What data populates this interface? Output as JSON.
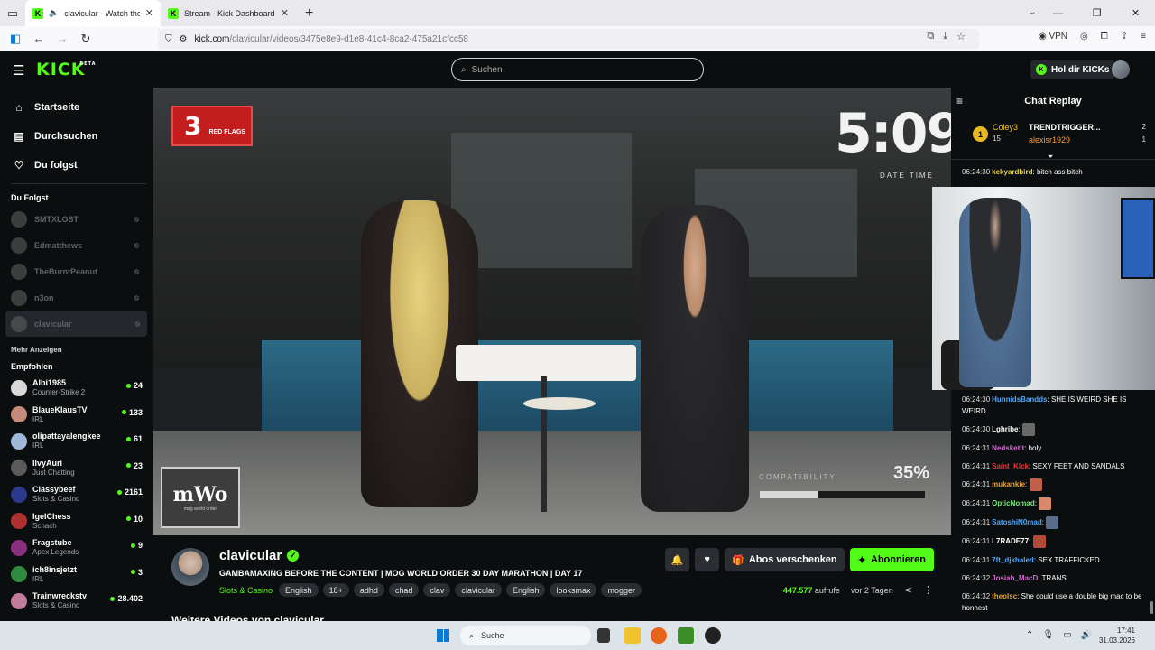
{
  "browser": {
    "tabs": [
      {
        "title": "clavicular - Watch the VOD",
        "active": true
      },
      {
        "title": "Stream - Kick Dashboard",
        "active": false
      }
    ],
    "url_host": "kick.com",
    "url_path": "/clavicular/videos/3475e8e9-d1e8-41c4-8ca2-475a21cfcc58",
    "vpn_label": "VPN"
  },
  "header": {
    "logo": "KICK",
    "logo_badge": "BETA",
    "search_placeholder": "Suchen",
    "kicks_button": "Hol dir KICKs"
  },
  "sidebar": {
    "nav": [
      {
        "label": "Startseite",
        "icon": "home-icon"
      },
      {
        "label": "Durchsuchen",
        "icon": "browse-icon"
      },
      {
        "label": "Du folgst",
        "icon": "heart-icon"
      }
    ],
    "following_title": "Du Folgst",
    "following": [
      {
        "name": "SMTXLOST"
      },
      {
        "name": "Edmatthews"
      },
      {
        "name": "TheBurntPeanut"
      },
      {
        "name": "n3on"
      },
      {
        "name": "clavicular"
      }
    ],
    "show_more": "Mehr Anzeigen",
    "recommended_title": "Empfohlen",
    "recommended": [
      {
        "name": "Albi1985",
        "category": "Counter-Strike 2",
        "viewers": "24",
        "color": "#d9d9d9"
      },
      {
        "name": "BlaueKlausTV",
        "category": "IRL",
        "viewers": "133",
        "color": "#c48a7a"
      },
      {
        "name": "olipattayalengkee",
        "category": "IRL",
        "viewers": "61",
        "color": "#9fb7d9"
      },
      {
        "name": "IlvyAuri",
        "category": "Just Chatting",
        "viewers": "23",
        "color": "#5a5a5a"
      },
      {
        "name": "Classybeef",
        "category": "Slots & Casino",
        "viewers": "2161",
        "color": "#2b3a8c"
      },
      {
        "name": "IgelChess",
        "category": "Schach",
        "viewers": "10",
        "color": "#b03030"
      },
      {
        "name": "Fragstube",
        "category": "Apex Legends",
        "viewers": "9",
        "color": "#8a2f7e"
      },
      {
        "name": "ich8insjetzt",
        "category": "IRL",
        "viewers": "3",
        "color": "#2e8a3c"
      },
      {
        "name": "Trainwreckstv",
        "category": "Slots & Casino",
        "viewers": "28.402",
        "color": "#c07a9a"
      }
    ]
  },
  "video": {
    "flags_count": "3",
    "flags_label": "RED FLAGS",
    "timer": "5:09",
    "timer_label": "DATE TIME",
    "compat_label": "COMPATIBILITY",
    "compat_value": "35%",
    "compat_fraction": 0.35,
    "watermark_big": "mWo",
    "watermark_small": "mog world order"
  },
  "stream": {
    "channel": "clavicular",
    "title": "GAMBAMAXING BEFORE THE CONTENT | MOG WORLD ORDER 30 DAY MARATHON | DAY 17",
    "category": "Slots & Casino",
    "tags": [
      "English",
      "18+",
      "adhd",
      "chad",
      "clav",
      "clavicular",
      "English",
      "looksmax",
      "mogger"
    ],
    "views": "447.577",
    "views_label": "aufrufe",
    "age": "vor 2 Tagen",
    "gift_subs": "Abos verschenken",
    "subscribe": "Abonnieren",
    "more_videos": "Weitere Videos von clavicular"
  },
  "chat": {
    "title": "Chat Replay",
    "leaderboard": {
      "left_rank": "1",
      "left_name": "Coley3",
      "left_count": "15",
      "right": [
        {
          "name": "TRENDTRIGGER...",
          "count": "2"
        },
        {
          "name": "alexisr1929",
          "count": "1"
        }
      ]
    },
    "messages": [
      {
        "time": "06:24:30",
        "user": "kekyardbird",
        "color": "#e8d642",
        "text": "bitch ass bitch"
      },
      {
        "time": "06:24:30",
        "user": "HunnidsBandds",
        "color": "#4fa7ff",
        "text": "SHE IS WEIRD SHE IS WEIRD"
      },
      {
        "time": "06:24:30",
        "user": "Lghribe",
        "color": "#ffffff",
        "text": "",
        "emote": "#6a6a6a"
      },
      {
        "time": "06:24:31",
        "user": "Nedsketit",
        "color": "#d46bd2",
        "text": "holy"
      },
      {
        "time": "06:24:31",
        "user": "Saint_Kick",
        "color": "#e23b3b",
        "text": "SEXY FEET AND SANDALS"
      },
      {
        "time": "06:24:31",
        "user": "mukankie",
        "color": "#e8a23a",
        "text": "",
        "emote": "#c0604a"
      },
      {
        "time": "06:24:31",
        "user": "OpticNomad",
        "color": "#7fe37f",
        "text": "",
        "emote": "#d98a6a"
      },
      {
        "time": "06:24:31",
        "user": "SatoshiN0mad",
        "color": "#4fa7ff",
        "text": "",
        "emote": "#5a6c8a"
      },
      {
        "time": "06:24:31",
        "user": "L7RADE77",
        "color": "#ffffff",
        "text": "",
        "emote": "#b24a3a"
      },
      {
        "time": "06:24:31",
        "user": "7ft_djkhaled",
        "color": "#4fa7ff",
        "text": "SEX TRAFFICKED"
      },
      {
        "time": "06:24:32",
        "user": "Josiah_MacD",
        "color": "#d46bd2",
        "text": "TRANS"
      },
      {
        "time": "06:24:32",
        "user": "theolsc",
        "color": "#e8a23a",
        "text": "She could use a double big mac to be honnest"
      }
    ]
  },
  "taskbar": {
    "search": "Suche",
    "time": "17:41",
    "date": "31.03.2026"
  }
}
